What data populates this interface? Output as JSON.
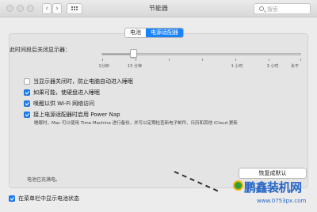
{
  "window": {
    "title": "节能器"
  },
  "toolbar": {
    "back": "‹",
    "forward": "›",
    "search_placeholder": "搜索"
  },
  "tabs": [
    {
      "label": "电池",
      "active": false
    },
    {
      "label": "电源适配器",
      "active": true
    }
  ],
  "sleep_slider": {
    "label": "此时间段后关闭显示器：",
    "ticks": [
      "1分钟",
      "15 分钟",
      "1 小时",
      "3 小时",
      "永不"
    ],
    "value_fraction": 0.16
  },
  "options": [
    {
      "label": "当显示器关闭时，防止电脑自动进入睡眠",
      "checked": false
    },
    {
      "label": "如果可能，使硬盘进入睡眠",
      "checked": true
    },
    {
      "label": "唤醒以供 Wi-Fi 网络访问",
      "checked": true
    },
    {
      "label": "接上电源适配器时启用 Power Nap",
      "checked": true
    }
  ],
  "power_nap_desc": "睡眠时，Mac 可以使用 Time Machine 进行备份，并可以定期检查新电子邮件、日历和其他 iCloud 更新",
  "battery_status": "电池已充满电。",
  "restore_button": "恢复成默认",
  "menubar_option": {
    "label": "在菜单栏中显示电池状态",
    "checked": true
  },
  "watermark": {
    "main": "鹏鑫装机网",
    "sub": "www.0753px.com"
  },
  "colors": {
    "accent": "#1a82fb",
    "watermark": "#2766c6"
  }
}
